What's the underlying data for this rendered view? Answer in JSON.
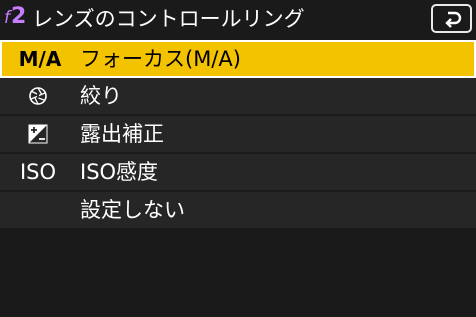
{
  "header": {
    "code_prefix": "f",
    "code_number": "2",
    "title": "レンズのコントロールリング"
  },
  "back_button": {
    "icon": "return-arrow-icon"
  },
  "colors": {
    "accent_code": "#c77dff",
    "selected_row": "#f4c300",
    "row_background": "#262626",
    "page_background": "#1a1a1a"
  },
  "menu": {
    "items": [
      {
        "icon_text": "M/A",
        "icon": "manual-auto-focus-icon",
        "label": "フォーカス(M/A)",
        "selected": true
      },
      {
        "icon_text": "",
        "icon": "aperture-icon",
        "label": "絞り",
        "selected": false
      },
      {
        "icon_text": "",
        "icon": "exposure-compensation-icon",
        "label": "露出補正",
        "selected": false
      },
      {
        "icon_text": "ISO",
        "icon": "iso-icon",
        "label": "ISO感度",
        "selected": false
      },
      {
        "icon_text": "",
        "icon": "",
        "label": "設定しない",
        "selected": false
      }
    ]
  }
}
